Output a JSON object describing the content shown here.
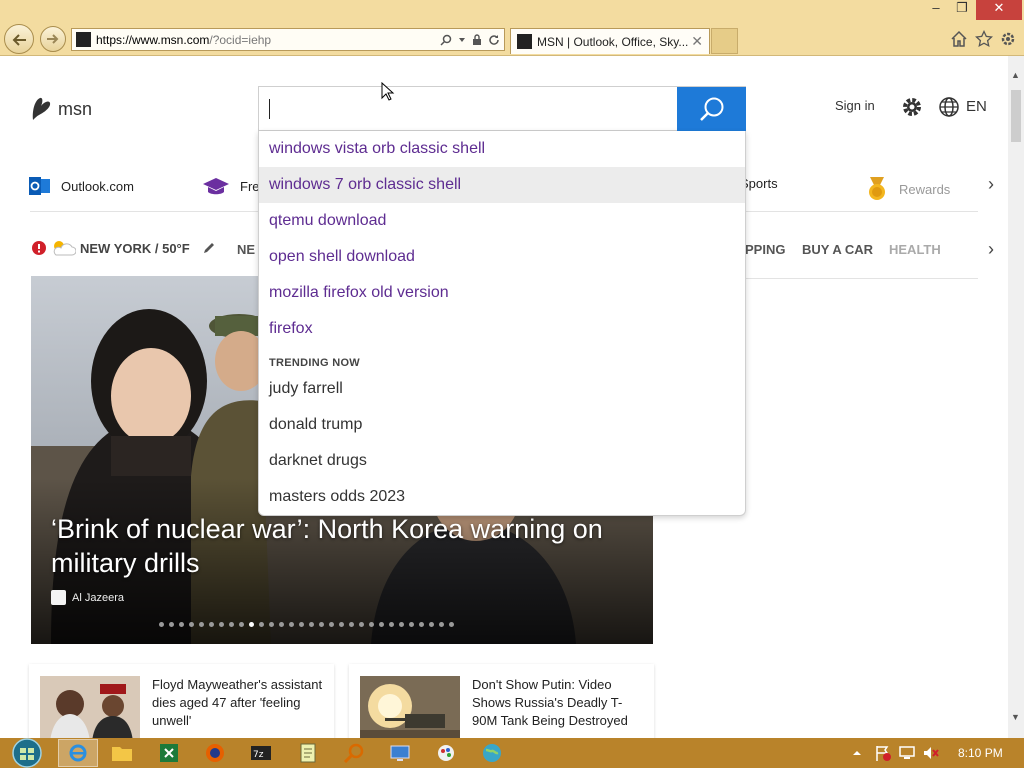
{
  "browser": {
    "url_domain": "https://www.msn.com",
    "url_rest": "/?ocid=iehp",
    "tab_title": "MSN | Outlook, Office, Sky...",
    "tab_close": "✕",
    "window_min": "–",
    "window_max": "❐",
    "window_close": "✕"
  },
  "header": {
    "logo_text": "msn",
    "sign_in": "Sign in",
    "language": "EN"
  },
  "search": {
    "value": "",
    "suggestions": [
      "windows vista orb classic shell",
      "windows 7 orb classic shell",
      "qtemu download",
      "open shell download",
      "mozilla firefox old version",
      "firefox"
    ],
    "trending_heading": "TRENDING NOW",
    "trending": [
      "judy farrell",
      "donald trump",
      "darknet drugs",
      "masters odds 2023"
    ]
  },
  "quicklinks": {
    "outlook": "Outlook.com",
    "free": "Free",
    "sports": "Sports",
    "rewards": "Rewards"
  },
  "nav": {
    "weather": "NEW YORK / 50°F",
    "news": "NE",
    "shopping": "PPING",
    "car": "BUY A CAR",
    "health": "HEALTH"
  },
  "hero": {
    "title": "‘Brink of nuclear war’: North Korea warning on military drills",
    "source": "Al Jazeera",
    "slide_count": 30,
    "active_slide": 9
  },
  "cards": [
    {
      "headline": "Floyd Mayweather's assistant dies aged 47 after 'feeling unwell'"
    },
    {
      "headline": "Don't Show Putin: Video Shows Russia's Deadly T-90M Tank Being Destroyed"
    }
  ],
  "taskbar": {
    "time": "8:10 PM"
  },
  "colors": {
    "chrome": "#f3dca0",
    "search_button": "#1e7ad8",
    "suggestion_text": "#5e2c91",
    "taskbar": "#b9832a"
  }
}
